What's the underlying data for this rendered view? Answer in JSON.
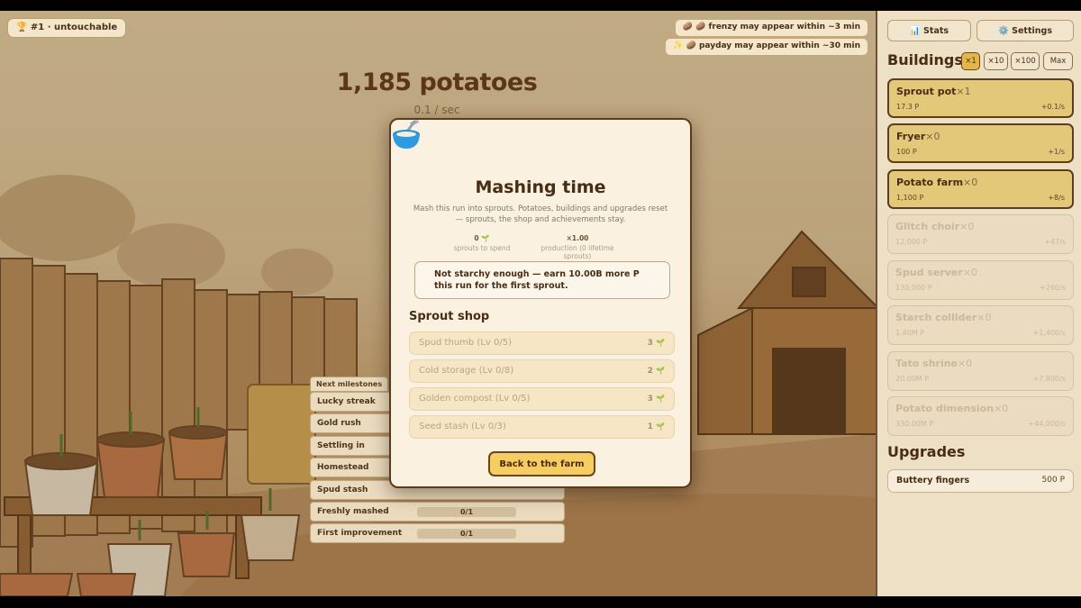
{
  "header": {
    "rank_badge": "🏆 #1 · untouchable",
    "frenzy_notice": "🥔 🥔 frenzy may appear within ~3 min",
    "payday_notice": "✨ 🥔 payday may appear within ~30 min"
  },
  "counter": {
    "potatoes": "1,185 potatoes",
    "rate": "0.1 / sec"
  },
  "milestones": {
    "heading": "Next milestones",
    "items": [
      {
        "name": "Lucky streak",
        "progress": ""
      },
      {
        "name": "Gold rush",
        "progress": ""
      },
      {
        "name": "Settling in",
        "progress": ""
      },
      {
        "name": "Homestead",
        "progress": ""
      },
      {
        "name": "Spud stash",
        "progress": ""
      },
      {
        "name": "Freshly mashed",
        "progress": "0/1"
      },
      {
        "name": "First improvement",
        "progress": "0/1"
      }
    ]
  },
  "modal": {
    "title": "Mashing time",
    "description": "Mash this run into sprouts. Potatoes, buildings and upgrades reset — sprouts, the shop and achievements stay.",
    "stats": [
      {
        "value": "0 🌱",
        "label": "sprouts to spend"
      },
      {
        "value": "×1.00",
        "label": "production (0 lifetime sprouts)"
      }
    ],
    "notice": "Not starchy enough — earn 10.00B more P this run for the first sprout.",
    "shop_title": "Sprout shop",
    "shop_items": [
      {
        "name": "Spud thumb (Lv 0/5)",
        "cost": "3"
      },
      {
        "name": "Cold storage (Lv 0/8)",
        "cost": "2"
      },
      {
        "name": "Golden compost (Lv 0/5)",
        "cost": "3"
      },
      {
        "name": "Seed stash (Lv 0/3)",
        "cost": "1"
      }
    ],
    "sprout_icon": "🌱",
    "back_button": "Back to the farm"
  },
  "panel": {
    "stats_button": "📊 Stats",
    "settings_button": "⚙️ Settings",
    "buildings_title": "Buildings",
    "multipliers": [
      "×1",
      "×10",
      "×100",
      "Max"
    ],
    "active_multiplier": "×1",
    "buildings": [
      {
        "name": "Sprout pot",
        "owned": "×1",
        "cost": "17.3 P",
        "rate": "+0.1/s",
        "locked": false
      },
      {
        "name": "Fryer",
        "owned": "×0",
        "cost": "100 P",
        "rate": "+1/s",
        "locked": false
      },
      {
        "name": "Potato farm",
        "owned": "×0",
        "cost": "1,100 P",
        "rate": "+8/s",
        "locked": false
      },
      {
        "name": "Glitch choir",
        "owned": "×0",
        "cost": "12,000 P",
        "rate": "+47/s",
        "locked": true
      },
      {
        "name": "Spud server",
        "owned": "×0",
        "cost": "130,000 P",
        "rate": "+260/s",
        "locked": true
      },
      {
        "name": "Starch collider",
        "owned": "×0",
        "cost": "1.40M P",
        "rate": "+1,400/s",
        "locked": true
      },
      {
        "name": "Tato shrine",
        "owned": "×0",
        "cost": "20.00M P",
        "rate": "+7,800/s",
        "locked": true
      },
      {
        "name": "Potato dimension",
        "owned": "×0",
        "cost": "330.00M P",
        "rate": "+44,000/s",
        "locked": true
      }
    ],
    "upgrades_title": "Upgrades",
    "upgrades": [
      {
        "name": "Buttery fingers",
        "cost": "500 P"
      }
    ]
  },
  "colors": {
    "accent": "#e3b64c",
    "panel_bg": "#eee0c4",
    "modal_bg": "#faf1e1",
    "button": "#f5cd64"
  }
}
